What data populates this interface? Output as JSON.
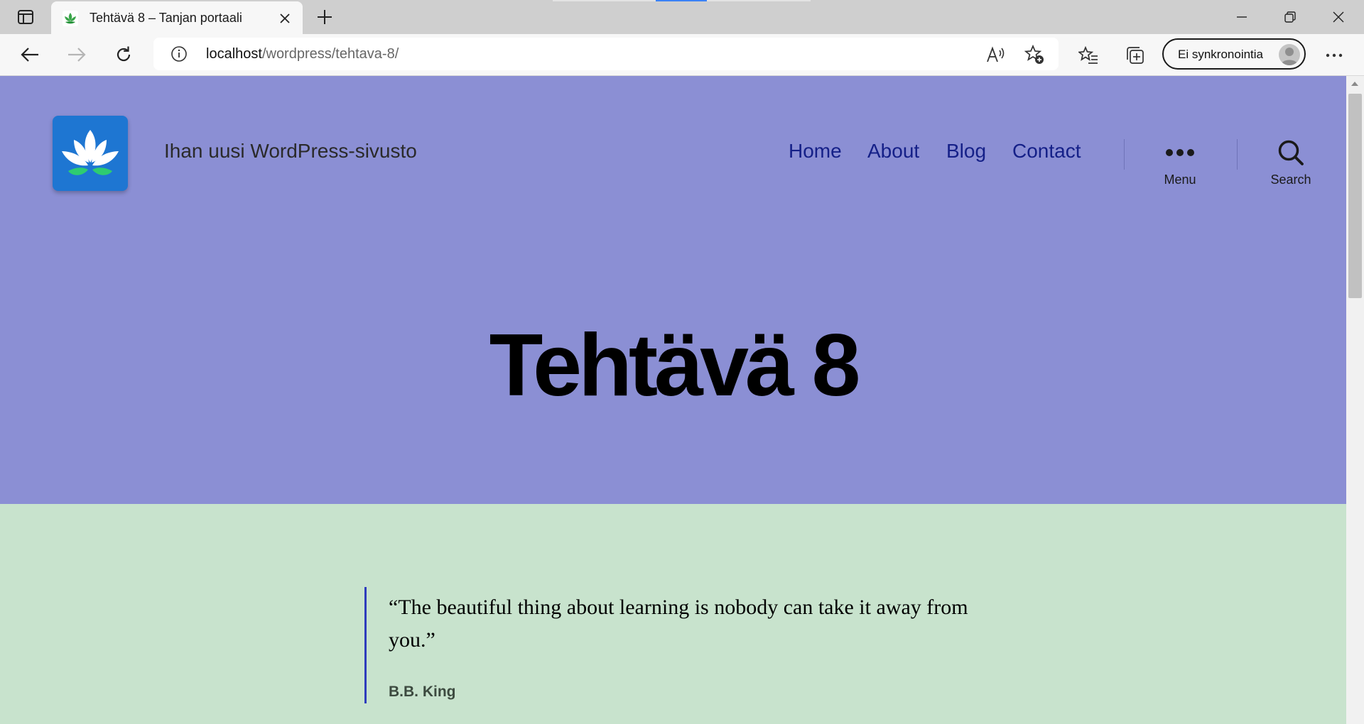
{
  "browser": {
    "tab": {
      "title": "Tehtävä 8 – Tanjan portaali",
      "favicon": "lotus-icon"
    },
    "address_bar": {
      "host": "localhost",
      "path": "/wordpress/tehtava-8/"
    },
    "profile_button_label": "Ei synkronointia",
    "accent_color": "#3b82f6"
  },
  "site": {
    "title": "Ihan uusi WordPress-sivusto",
    "logo": "lotus-icon",
    "header_background": "#8b8fd4",
    "content_background": "#c8e3cd",
    "link_color": "#152088",
    "nav": [
      {
        "label": "Home"
      },
      {
        "label": "About"
      },
      {
        "label": "Blog"
      },
      {
        "label": "Contact"
      }
    ],
    "menu_toggle_label": "Menu",
    "search_toggle_label": "Search"
  },
  "page": {
    "title": "Tehtävä 8",
    "quote": {
      "text": "“The beautiful thing about learning is nobody can take it away from you.”",
      "citation": "B.B. King",
      "border_color": "#2f3dbd"
    }
  }
}
